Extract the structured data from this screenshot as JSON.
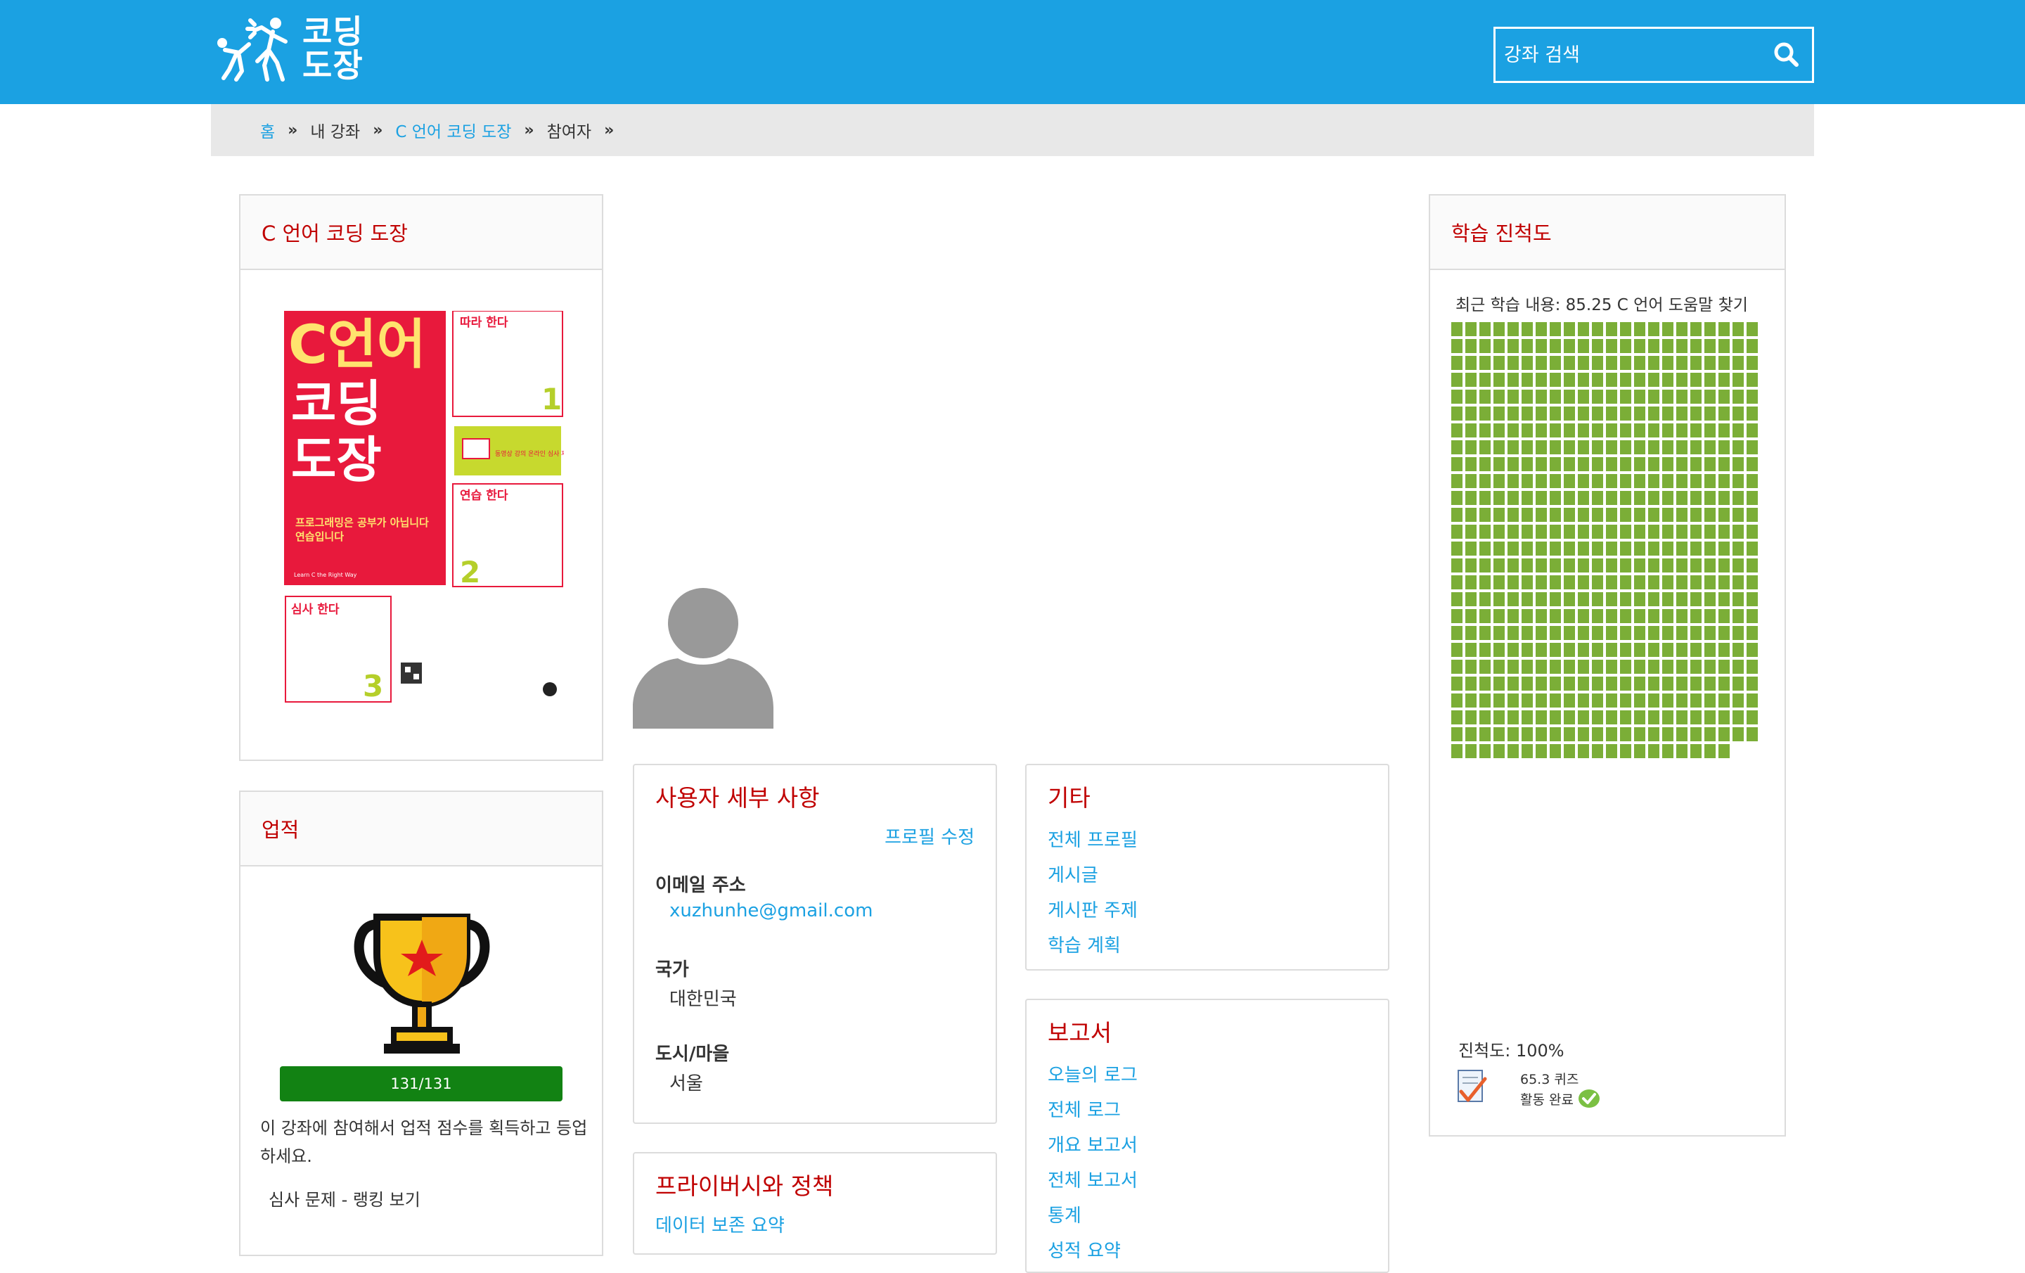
{
  "header": {
    "logo_line1": "코딩",
    "logo_line2": "도장",
    "search_placeholder": "강좌 검색",
    "brand_color": "#1ba1e2"
  },
  "breadcrumb": [
    {
      "label": "홈",
      "link": true
    },
    {
      "label": "내 강좌",
      "link": false
    },
    {
      "label": "C 언어 코딩 도장",
      "link": true
    },
    {
      "label": "참여자",
      "link": false
    }
  ],
  "course_block": {
    "title": "C 언어 코딩 도장",
    "book": {
      "title_line1": "C언어",
      "title_line2": "코딩",
      "title_line3": "도장",
      "subtitle_line1": "프로그래밍은 공부가 아닙니다",
      "subtitle_line2": "연습입니다",
      "english": "Learn C the Right Way",
      "step1": "따라 한다",
      "step2": "연습 한다",
      "step3": "심사 한다",
      "num1": "1",
      "num2": "2",
      "num3": "3",
      "video_note": "동영상 강의 온라인 심사 제공"
    }
  },
  "achievements": {
    "title": "업적",
    "progress": "131/131",
    "progress_value": 1.0,
    "description": "이 강좌에 참여해서 업적 점수를 획득하고 등업하세요.",
    "ranking": "심사 문제 - 랭킹 보기"
  },
  "user_details": {
    "title": "사용자 세부 사항",
    "edit_profile": "프로필 수정",
    "email_label": "이메일 주소",
    "email_value": "xuzhunhe@gmail.com",
    "country_label": "국가",
    "country_value": "대한민국",
    "city_label": "도시/마을",
    "city_value": "서울"
  },
  "privacy": {
    "title": "프라이버시와 정책",
    "link": "데이터 보존 요약"
  },
  "misc": {
    "title": "기타",
    "links": [
      "전체 프로필",
      "게시글",
      "게시판 주제",
      "학습 계획"
    ]
  },
  "reports": {
    "title": "보고서",
    "links": [
      "오늘의 로그",
      "전체 로그",
      "개요 보고서",
      "전체 보고서",
      "통계",
      "성적 요약"
    ]
  },
  "progress_block": {
    "title": "학습 진척도",
    "recent": "최근 학습 내용: 85.25 C 언어 도움말 찾기",
    "completed_items": 570,
    "progress_text": "진척도: 100%",
    "quiz_name": "65.3 퀴즈",
    "quiz_status": "활동 완료",
    "cell_color": "#7bae37"
  }
}
